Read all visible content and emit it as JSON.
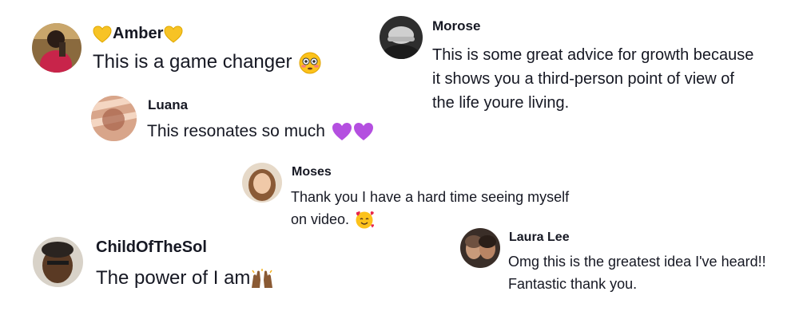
{
  "comments": [
    {
      "username_prefix_icon": "yellow-heart-icon",
      "username": "Amber",
      "username_suffix_icon": "yellow-heart-icon",
      "text": "This is a game changer",
      "text_emoji": "flushed-face-icon"
    },
    {
      "username": "Morose",
      "text_lines": [
        "This is some great advice for growth because",
        "it shows you a third-person point of view of",
        "the life youre living."
      ]
    },
    {
      "username": "Luana",
      "text": "This resonates so much",
      "text_emoji": "purple-hearts-icon"
    },
    {
      "username": "Moses",
      "text_lines": [
        "Thank you I have a hard time seeing myself",
        "on video."
      ],
      "text_emoji": "smiling-face-with-hearts-icon"
    },
    {
      "username": "ChildOfTheSol",
      "text": "The power of I am",
      "text_emoji": "raising-hands-icon"
    },
    {
      "username": "Laura Lee",
      "text_lines": [
        "Omg this is the greatest idea I've heard!!",
        "Fantastic thank you."
      ]
    }
  ]
}
